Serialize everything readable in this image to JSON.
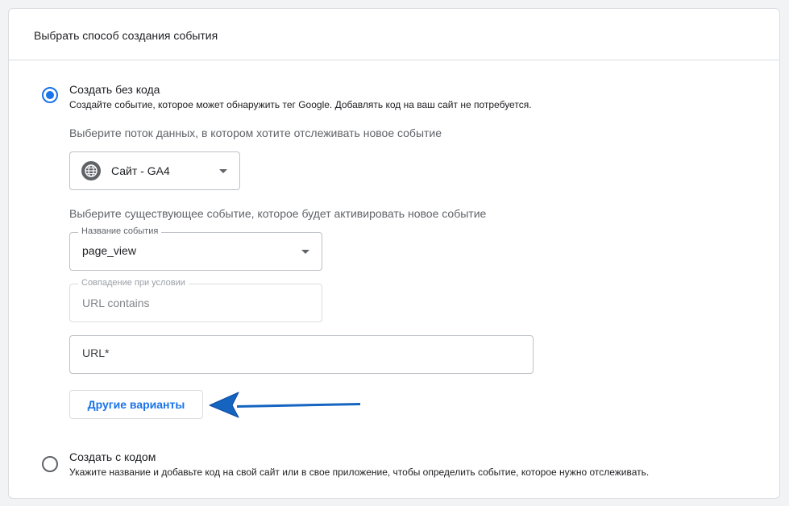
{
  "header": {
    "title": "Выбрать способ создания события"
  },
  "option_no_code": {
    "title": "Создать без кода",
    "description": "Создайте событие, которое может обнаружить тег Google. Добавлять код на ваш сайт не потребуется."
  },
  "stream": {
    "prompt": "Выберите поток данных, в котором хотите отслеживать новое событие",
    "value": "Сайт - GA4",
    "icon": "globe-icon"
  },
  "existing_event": {
    "prompt": "Выберите существующее событие, которое будет активировать новое событие",
    "label": "Название события",
    "value": "page_view"
  },
  "condition": {
    "label": "Совпадение при условии",
    "value": "URL contains"
  },
  "url_field": {
    "placeholder": "URL*"
  },
  "more_options": {
    "label": "Другие варианты"
  },
  "option_with_code": {
    "title": "Создать с кодом",
    "description": "Укажите название и добавьте код на свой сайт или в свое приложение, чтобы определить событие, которое нужно отслеживать."
  },
  "colors": {
    "accent": "#1a73e8",
    "arrow": "#1565c0",
    "border": "#dadce0"
  }
}
